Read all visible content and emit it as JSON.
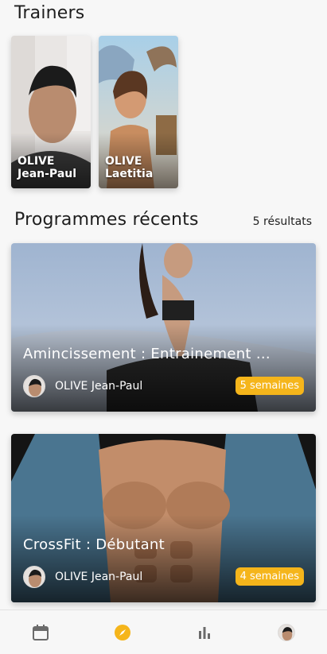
{
  "sections": {
    "trainers_title": "Trainers",
    "programs_title": "Programmes récents",
    "results_count": "5 résultats"
  },
  "trainers": [
    {
      "first": "OLIVE",
      "last": "Jean-Paul"
    },
    {
      "first": "OLIVE",
      "last": "Laetitia"
    }
  ],
  "programs": [
    {
      "title": "Amincissement :  Entrainement ...",
      "author": "OLIVE Jean-Paul",
      "duration": "5 semaines"
    },
    {
      "title": "CrossFit : Débutant",
      "author": "OLIVE Jean-Paul",
      "duration": "4 semaines"
    }
  ],
  "nav": {
    "items": [
      "calendar-icon",
      "compass-icon",
      "bar-chart-icon",
      "profile-avatar"
    ],
    "active": "compass-icon",
    "accent": "#f5b51b"
  }
}
